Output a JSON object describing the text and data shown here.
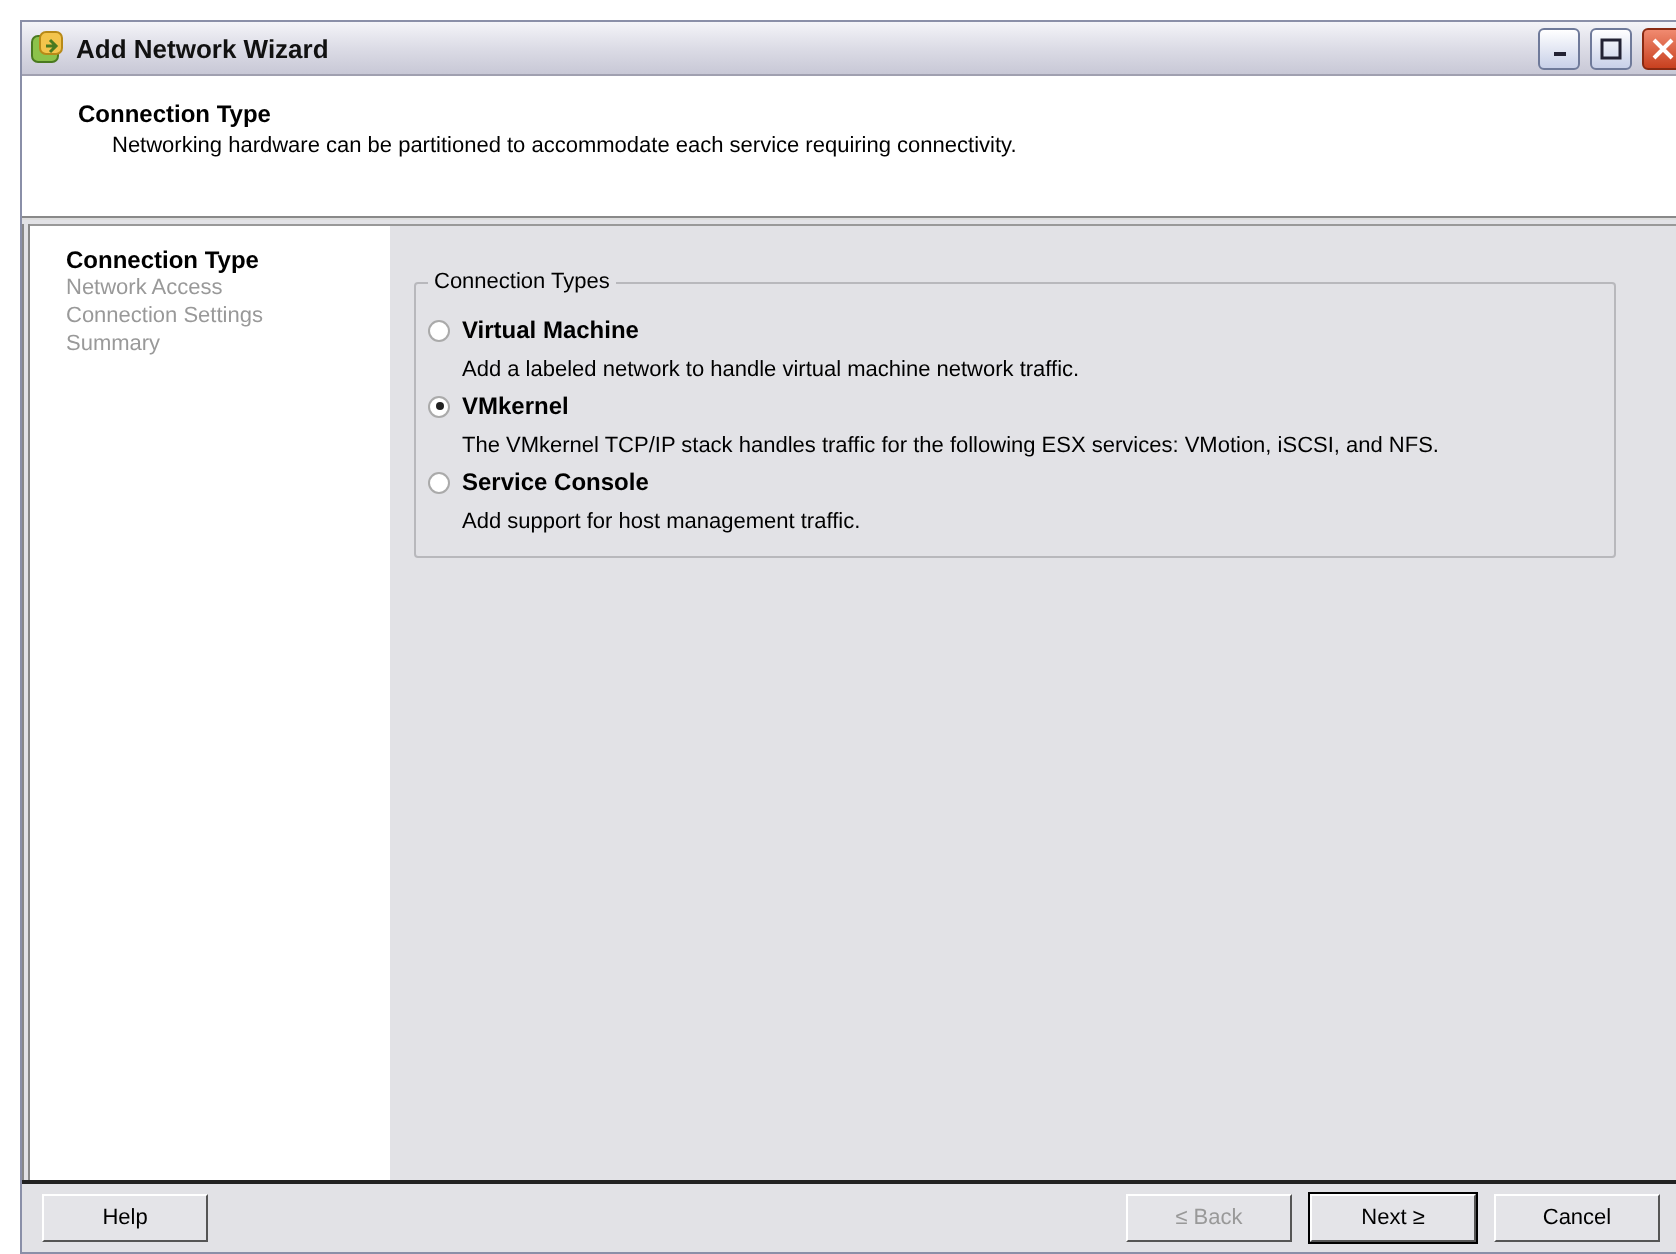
{
  "window": {
    "title": "Add Network Wizard"
  },
  "header": {
    "title": "Connection Type",
    "description": "Networking hardware can be partitioned to accommodate each service requiring connectivity."
  },
  "steps": [
    {
      "label": "Connection Type",
      "selected": true
    },
    {
      "label": "Network Access",
      "selected": false
    },
    {
      "label": "Connection Settings",
      "selected": false
    },
    {
      "label": "Summary",
      "selected": false
    }
  ],
  "group": {
    "title": "Connection Types",
    "options": [
      {
        "label": "Virtual Machine",
        "description": "Add a labeled network to handle virtual machine network traffic.",
        "selected": false
      },
      {
        "label": "VMkernel",
        "description": "The VMkernel TCP/IP stack handles traffic for the following ESX services:  VMotion, iSCSI, and  NFS.",
        "selected": true
      },
      {
        "label": "Service Console",
        "description": "Add support for host management traffic.",
        "selected": false
      }
    ]
  },
  "buttons": [
    {
      "label": "Help",
      "kind": "help",
      "disabled": false,
      "default": false
    },
    {
      "label": "≤ Back",
      "kind": "back",
      "disabled": true,
      "default": false
    },
    {
      "label": "Next ≥",
      "kind": "next",
      "disabled": false,
      "default": true
    },
    {
      "label": "Cancel",
      "kind": "cancel",
      "disabled": false,
      "default": false
    }
  ]
}
